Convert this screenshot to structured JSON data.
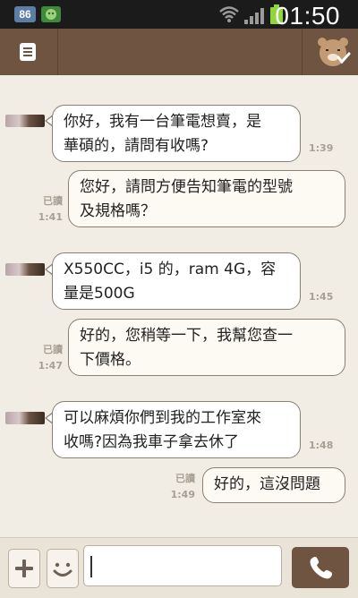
{
  "status_bar": {
    "notification_badge": "86",
    "time": "01:50",
    "icons": [
      "app-badge-icon",
      "wifi-icon",
      "signal-icon",
      "battery-icon"
    ]
  },
  "header": {
    "left_icon": "menu-document-icon",
    "right_icon": "bear-face-icon"
  },
  "messages": [
    {
      "side": "in",
      "lines": [
        "你好，我有一台筆電想賣，是",
        "華碩的，請問有收嗎?"
      ],
      "time": "1:39",
      "read": ""
    },
    {
      "side": "out",
      "lines": [
        "您好，請問方便告知筆電的型號",
        "及規格嗎？"
      ],
      "time": "1:41",
      "read": "已讀"
    },
    {
      "side": "in",
      "lines": [
        "X550CC，i5 的，ram 4G，容",
        "量是500G"
      ],
      "time": "1:45",
      "read": ""
    },
    {
      "side": "out",
      "lines": [
        "好的，您稍等一下，我幫您查一",
        "下價格。"
      ],
      "time": "1:47",
      "read": "已讀"
    },
    {
      "side": "in",
      "lines": [
        "可以麻煩你們到我的工作室來",
        "收嗎?因為我車子拿去休了"
      ],
      "time": "1:48",
      "read": ""
    },
    {
      "side": "out",
      "lines": [
        "好的，這沒問題"
      ],
      "time": "1:49",
      "read": "已讀"
    }
  ],
  "composer": {
    "plus_icon": "plus-icon",
    "emoji_icon": "smiley-icon",
    "input_value": "",
    "input_placeholder": "",
    "send_icon": "phone-icon"
  },
  "colors": {
    "header_brown": "#6f5441",
    "chat_background": "#f1ede4",
    "bubble_border": "#8a7f73",
    "battery_green": "#8fd63a"
  }
}
